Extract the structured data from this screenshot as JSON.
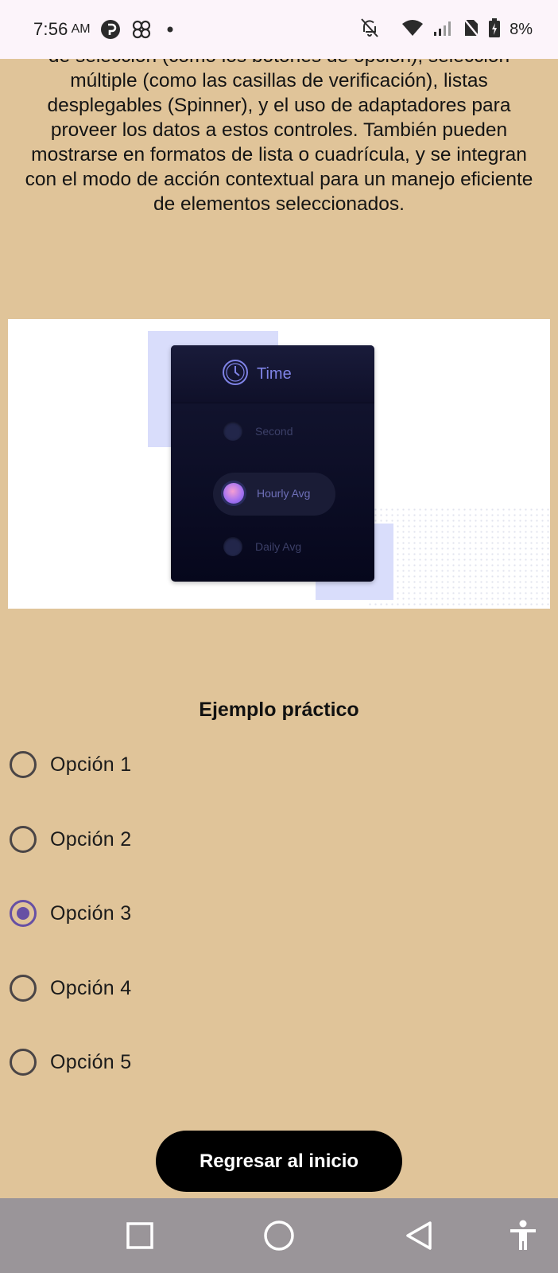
{
  "status_bar": {
    "time": "7:56",
    "ampm": "AM",
    "icons": [
      "pinterest-icon",
      "pinwheel-icon",
      "notification-dot-icon",
      "bell-off-icon",
      "wifi-icon",
      "signal-icon",
      "no-sim-icon",
      "battery-charging-icon"
    ],
    "battery": "8%"
  },
  "description": {
    "text": "de selección (como los botones de opción), selección múltiple (como las casillas de verificación), listas desplegables (Spinner), y el uso de adaptadores para proveer los datos a estos controles. También pueden mostrarse en formatos de lista o cuadrícula, y se integran con el modo de acción contextual para un manejo eficiente de elementos seleccionados."
  },
  "illustration": {
    "title": "Time",
    "options": [
      {
        "label": "Second",
        "selected": false
      },
      {
        "label": "Hourly Avg",
        "selected": true
      },
      {
        "label": "Daily Avg",
        "selected": false
      }
    ],
    "colors": {
      "card": "#0B0D26",
      "accent": "#7F83E6",
      "square": "#D9DDFB"
    }
  },
  "section": {
    "title": "Ejemplo práctico"
  },
  "radio_group": {
    "options": [
      {
        "label": "Opción 1",
        "checked": false
      },
      {
        "label": "Opción 2",
        "checked": false
      },
      {
        "label": "Opción 3",
        "checked": true
      },
      {
        "label": "Opción 4",
        "checked": false
      },
      {
        "label": "Opción 5",
        "checked": false
      }
    ],
    "accent_color": "#6750A4"
  },
  "home_button": {
    "label": "Regresar al inicio"
  },
  "nav_bar": {
    "buttons": [
      "recents-icon",
      "home-icon",
      "back-icon",
      "accessibility-icon"
    ]
  },
  "colors": {
    "background": "#E0C499",
    "status_bar": "#FCF4FA",
    "nav_bar": "#9A9599",
    "button": "#000000"
  }
}
